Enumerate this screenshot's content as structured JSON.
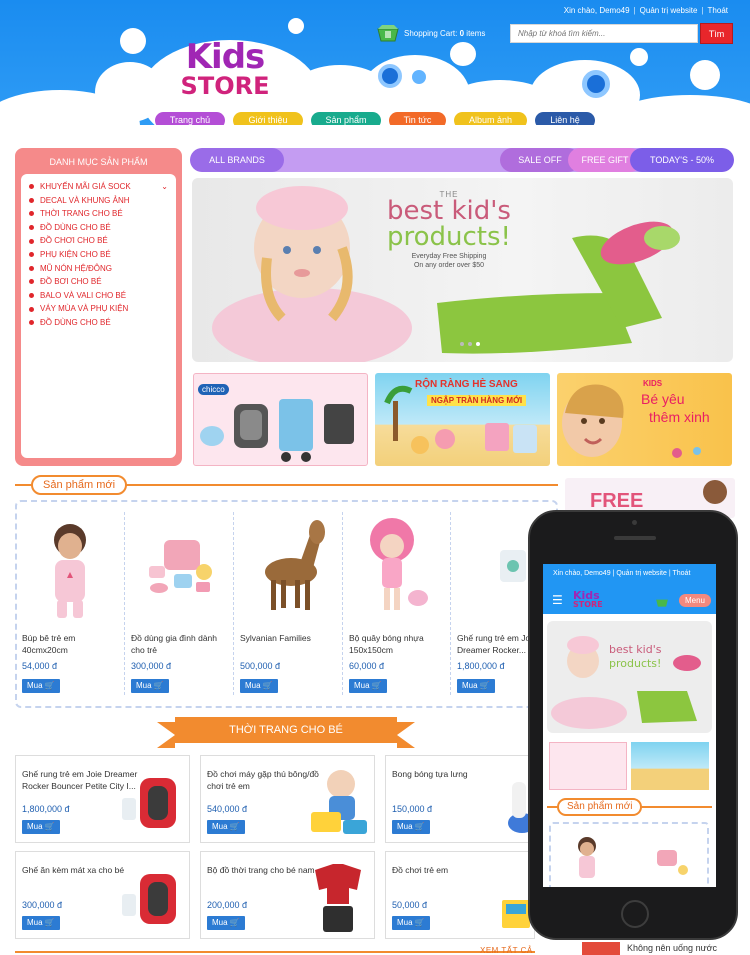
{
  "header": {
    "greeting": "Xin chào, Demo49",
    "admin_link": "Quản trị website",
    "logout_link": "Thoát",
    "search_placeholder": "Nhập từ khoá tìm kiếm...",
    "search_button": "Tìm",
    "cart_label": "Shopping Cart:",
    "cart_count": "0",
    "cart_items": "items",
    "logo_line1": "Kids",
    "logo_line2": "STORE"
  },
  "nav": [
    {
      "label": "Trang chủ",
      "color": "#b44ed6"
    },
    {
      "label": "Giới thiệu",
      "color": "#f0c21c"
    },
    {
      "label": "Sản phẩm",
      "color": "#18ab8d"
    },
    {
      "label": "Tin tức",
      "color": "#f26a28"
    },
    {
      "label": "Album ảnh",
      "color": "#f0c21c"
    },
    {
      "label": "Liên hệ",
      "color": "#2b5aa8"
    }
  ],
  "sidebar": {
    "title": "DANH MỤC SẢN PHẨM",
    "items": [
      {
        "label": "Khuyến mãi giá sock"
      },
      {
        "label": "Decal và khung ảnh"
      },
      {
        "label": "Thời trang cho bé"
      },
      {
        "label": "Đồ dùng cho bé"
      },
      {
        "label": "Đồ chơi cho bé"
      },
      {
        "label": "Phụ kiện cho bé"
      },
      {
        "label": "Mũ nón hệ/đông"
      },
      {
        "label": "Đồ bơi cho bé"
      },
      {
        "label": "Balo và vali cho bé"
      },
      {
        "label": "Váy mùa và phụ kiện"
      },
      {
        "label": "Đồ dùng cho bé"
      }
    ]
  },
  "brandbar": {
    "all_brands": "ALL BRANDS",
    "sale_off": "SALE OFF",
    "free_gift": "FREE GIFT",
    "today": "TODAY'S - 50%"
  },
  "banner": {
    "the": "THE",
    "line1": "best kid's",
    "line2": "products!",
    "ship1": "Everyday Free Shipping",
    "ship2": "On any order over $50"
  },
  "promos": {
    "p1_brand": "chicco",
    "p2_line1": "RỘN RÀNG HÈ SANG",
    "p2_line2": "NGẬP TRÀN HÀNG MỚI",
    "p3_brand": "KIDS",
    "p3_line1": "Bé yêu",
    "p3_line2": "thêm xinh"
  },
  "new_products": {
    "title": "Sản phẩm mới",
    "buy": "Mua",
    "items": [
      {
        "name": "Búp bê trẻ em 40cmx20cm",
        "price": "54,000 đ"
      },
      {
        "name": "Đồ dùng gia đình dành cho trẻ",
        "price": "300,000 đ"
      },
      {
        "name": "Sylvanian Families",
        "price": "500,000 đ"
      },
      {
        "name": "Bộ quây bóng nhựa 150x150cm",
        "price": "60,000 đ"
      },
      {
        "name": "Ghế rung trẻ em Joie Dreamer Rocker...",
        "price": "1,800,000 đ"
      }
    ]
  },
  "fashion": {
    "title": "THỜI TRANG CHO BÉ",
    "buy": "Mua",
    "view_all": "XEM TẤT CẢ",
    "items": [
      {
        "name": "Ghế rung trẻ em Joie Dreamer Rocker Bouncer Petite City I...",
        "price": "1,800,000 đ"
      },
      {
        "name": "Đồ chơi máy gặp thú bông/đồ chơi trẻ em",
        "price": "540,000 đ"
      },
      {
        "name": "Bong bóng tựa lưng",
        "price": "150,000 đ"
      },
      {
        "name": "Ghế ăn kèm mát xa cho bé",
        "price": "300,000 đ"
      },
      {
        "name": "Bộ đồ thời trang cho bé nam",
        "price": "200,000 đ"
      },
      {
        "name": "Đồ chơi trẻ em",
        "price": "50,000 đ"
      }
    ]
  },
  "right_column": {
    "free_ad": "FREE",
    "bottom_text": "Không nên uống nước"
  },
  "phone": {
    "greeting": "Xin chào, Demo49",
    "admin_link": "Quản trị website",
    "logout_link": "Thoát",
    "logo_line1": "Kids",
    "logo_line2": "STORE",
    "menu_button": "Menu",
    "section_title": "Sản phẩm mới"
  },
  "colors": {
    "header_blue": "#1a8cf0",
    "accent_orange": "#f28b2f",
    "sidebar_pink": "#f58a8a",
    "price_blue": "#1f5fb0",
    "buy_blue": "#2c7bd3",
    "search_red": "#e8262b"
  }
}
